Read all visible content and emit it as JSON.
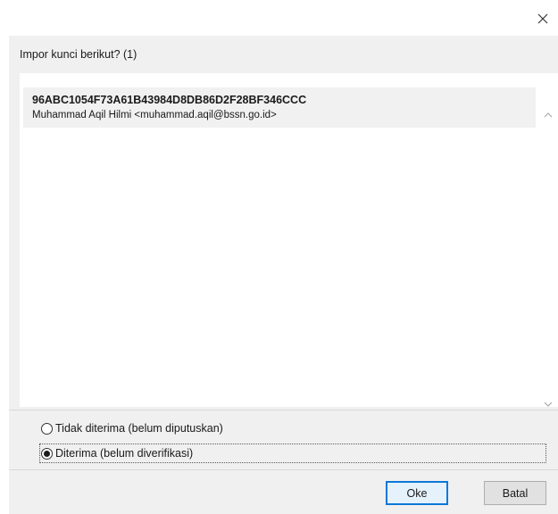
{
  "dialog": {
    "heading": "Impor kunci berikut? (1)",
    "close_icon": "close-icon"
  },
  "keys": [
    {
      "id": "96ABC1054F73A61B43984D8DB86D2F28BF346CCC",
      "user": "Muhammad Aqil Hilmi <muhammad.aqil@bssn.go.id>"
    }
  ],
  "options": [
    {
      "label": "Tidak diterima (belum diputuskan)",
      "checked": false
    },
    {
      "label": "Diterima (belum diverifikasi)",
      "checked": true
    }
  ],
  "buttons": {
    "ok_label": "Oke",
    "cancel_label": "Batal"
  },
  "colors": {
    "dialog_bg": "#f0f0f0",
    "list_bg": "#ffffff",
    "selected_row_bg": "#f1f1f1",
    "default_button_border": "#0a78d7"
  }
}
